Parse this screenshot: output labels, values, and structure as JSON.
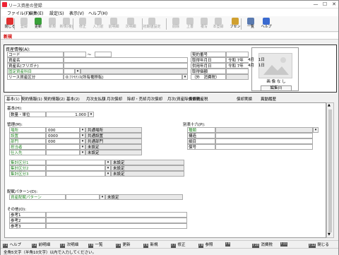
{
  "window": {
    "title": "リース資産の登録",
    "minimize": "—",
    "maximize": "☐",
    "close": "✕"
  },
  "menu": [
    "ファイル(F)",
    "編集(E)",
    "設定(S)",
    "表示(V)",
    "ヘルプ(H)"
  ],
  "toolbar": {
    "buttons": [
      {
        "label": "閉じる",
        "color": "#e03030",
        "disabled": false
      },
      {
        "label": "登録",
        "color": "#999999",
        "disabled": true
      },
      {
        "label": "更新",
        "color": "#3aa03a",
        "disabled": false
      },
      {
        "label": "新規",
        "color": "#999999",
        "disabled": true
      },
      {
        "label": "新規(複)",
        "color": "#999999",
        "disabled": true
      },
      {
        "label": "修正",
        "color": "#999999",
        "disabled": true
      },
      {
        "label": "入力前",
        "color": "#999999",
        "disabled": true
      },
      {
        "label": "前明細",
        "color": "#999999",
        "disabled": true
      },
      {
        "label": "次明細",
        "color": "#999999",
        "disabled": true
      },
      {
        "label": "初期値設定",
        "color": "#999999",
        "disabled": true
      },
      {
        "label": "削除",
        "color": "#999999",
        "disabled": true
      },
      {
        "label": "上書",
        "color": "#999999",
        "disabled": true
      },
      {
        "label": "複写",
        "color": "#999999",
        "disabled": true
      },
      {
        "label": "本登録",
        "color": "#999999",
        "disabled": true
      },
      {
        "label": "フセン",
        "color": "#d0a030",
        "disabled": false
      },
      {
        "label": "一覧",
        "color": "#5a7ab0",
        "disabled": false
      },
      {
        "label": "ヘルプ",
        "color": "#3a6ad0",
        "disabled": false
      }
    ]
  },
  "mode_label": "新規",
  "asset_info": {
    "header": "資産情報(A):",
    "code_label": "コード",
    "code_value": "",
    "name_label": "資産名",
    "name_value": "",
    "kana_label": "資産名(フリガナ)",
    "kana_value": "",
    "fixed_asset_label": "固定資産科目",
    "fixed_asset_value": "",
    "lease_category_label": "リース資産区分",
    "lease_category_value": "0:ﾌｧｲﾅﾝｽ(所有権移転)",
    "contract_no_label": "契約番号",
    "contract_no_value": "",
    "acquired_label": "取得年月日",
    "acquired_era": "令和",
    "acquired_year": "7年",
    "acquired_month": "4月",
    "acquired_day": "1日",
    "in_use_label": "供用年月日",
    "in_use_era": "令和",
    "in_use_year": "7年",
    "in_use_month": "4月",
    "in_use_day": "1日",
    "acq_value_label": "取得価額",
    "acq_value_value": "",
    "tax_note_label": "（外　消費税）",
    "tax_note_value": "",
    "image_caption": "画 像 な し",
    "image_edit_label": "編集(I)"
  },
  "tabs": [
    "基本(1)",
    "契約情報(1)",
    "契約情報(2)",
    "基本(2)",
    "月次支払額",
    "月次償却",
    "除却・売却",
    "月次償却",
    "月次(資産除去債務)",
    "償却資産税",
    "償却実績",
    "異動履歴"
  ],
  "basic": {
    "header": "基本(H):",
    "qty_label": "数量・単位",
    "qty_value": "1.000"
  },
  "management": {
    "header": "管理(M):",
    "rows": [
      {
        "label": "場所",
        "code": "000",
        "name": "共通場所",
        "green": true
      },
      {
        "label": "設置",
        "code": "0000",
        "name": "共通設置",
        "green": true
      },
      {
        "label": "部門",
        "code": "000",
        "name": "共通部門",
        "green": true
      },
      {
        "label": "担当者",
        "code": "",
        "name": "未設定",
        "green": true
      },
      {
        "label": "仕入先",
        "code": "",
        "name": "未設定",
        "green": true
      }
    ],
    "agg_rows": [
      {
        "label": "集計区分1",
        "name": "未設定"
      },
      {
        "label": "集計区分2",
        "name": "未設定"
      },
      {
        "label": "集計区分3",
        "name": "未設定"
      }
    ]
  },
  "table16": {
    "header": "別表十六(P):",
    "rows": [
      "種類",
      "構造",
      "細目",
      "償号"
    ]
  },
  "allocation": {
    "header": "配賦パターン(D):",
    "label": "資産配賦パターン",
    "name": "未設定"
  },
  "other": {
    "header": "その他(O):",
    "rows": [
      "参考1",
      "参考2",
      "参考3"
    ]
  },
  "fkeys": [
    {
      "key": "F1",
      "label": "ヘルプ"
    },
    {
      "key": "F2",
      "label": "前明細"
    },
    {
      "key": "F3",
      "label": "次明細"
    },
    {
      "key": "F4",
      "label": "一覧"
    },
    {
      "key": "F5",
      "label": "更新"
    },
    {
      "key": "F6",
      "label": "新規"
    },
    {
      "key": "F7",
      "label": "修正"
    },
    {
      "key": "F8",
      "label": "参照"
    },
    {
      "key": "F9",
      "label": ""
    },
    {
      "key": "F10",
      "label": "消費税"
    },
    {
      "key": "F11",
      "label": ""
    },
    {
      "key": "F12",
      "label": "閉じる"
    }
  ],
  "status_text": "全角5文字（半角10文字）以内で入力してください。"
}
